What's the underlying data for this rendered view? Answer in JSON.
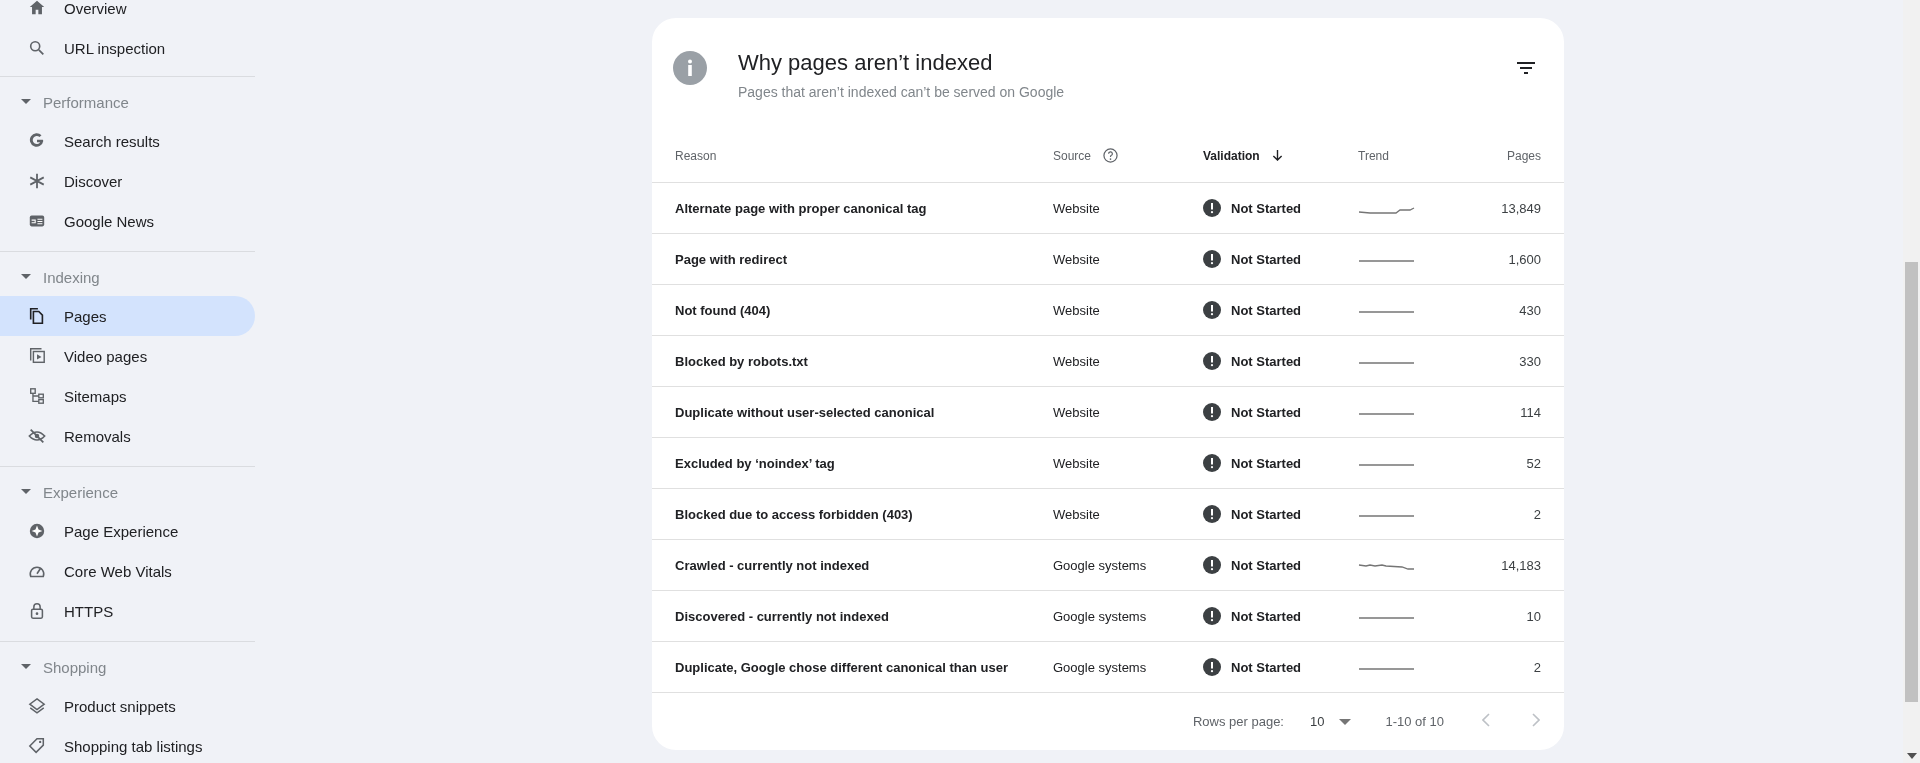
{
  "sidebar": {
    "top_items": [
      {
        "label": "Overview",
        "selected": false
      },
      {
        "label": "URL inspection",
        "selected": false
      }
    ],
    "sections": [
      {
        "title": "Performance",
        "expanded": true,
        "items": [
          {
            "label": "Search results",
            "selected": false
          },
          {
            "label": "Discover",
            "selected": false
          },
          {
            "label": "Google News",
            "selected": false
          }
        ]
      },
      {
        "title": "Indexing",
        "expanded": true,
        "items": [
          {
            "label": "Pages",
            "selected": true
          },
          {
            "label": "Video pages",
            "selected": false
          },
          {
            "label": "Sitemaps",
            "selected": false
          },
          {
            "label": "Removals",
            "selected": false
          }
        ]
      },
      {
        "title": "Experience",
        "expanded": true,
        "items": [
          {
            "label": "Page Experience",
            "selected": false
          },
          {
            "label": "Core Web Vitals",
            "selected": false
          },
          {
            "label": "HTTPS",
            "selected": false
          }
        ]
      },
      {
        "title": "Shopping",
        "expanded": true,
        "items": [
          {
            "label": "Product snippets",
            "selected": false
          },
          {
            "label": "Shopping tab listings",
            "selected": false
          }
        ]
      }
    ]
  },
  "card": {
    "title": "Why pages aren’t indexed",
    "subtitle": "Pages that aren’t indexed can’t be served on Google",
    "columns": [
      {
        "label": "Reason",
        "help": false,
        "sorted": false
      },
      {
        "label": "Source",
        "help": true,
        "sorted": false
      },
      {
        "label": "Validation",
        "help": false,
        "sorted": true
      },
      {
        "label": "Trend",
        "help": false,
        "sorted": false
      },
      {
        "label": "Pages",
        "help": false,
        "sorted": false
      }
    ],
    "rows": [
      {
        "reason": "Alternate page with proper canonical tag",
        "source": "Website",
        "validation": "Not Started",
        "pages": "13,849"
      },
      {
        "reason": "Page with redirect",
        "source": "Website",
        "validation": "Not Started",
        "pages": "1,600"
      },
      {
        "reason": "Not found (404)",
        "source": "Website",
        "validation": "Not Started",
        "pages": "430"
      },
      {
        "reason": "Blocked by robots.txt",
        "source": "Website",
        "validation": "Not Started",
        "pages": "330"
      },
      {
        "reason": "Duplicate without user-selected canonical",
        "source": "Website",
        "validation": "Not Started",
        "pages": "114"
      },
      {
        "reason": "Excluded by ‘noindex’ tag",
        "source": "Website",
        "validation": "Not Started",
        "pages": "52"
      },
      {
        "reason": "Blocked due to access forbidden (403)",
        "source": "Website",
        "validation": "Not Started",
        "pages": "2"
      },
      {
        "reason": "Crawled - currently not indexed",
        "source": "Google systems",
        "validation": "Not Started",
        "pages": "14,183"
      },
      {
        "reason": "Discovered - currently not indexed",
        "source": "Google systems",
        "validation": "Not Started",
        "pages": "10"
      },
      {
        "reason": "Duplicate, Google chose different canonical than user",
        "source": "Google systems",
        "validation": "Not Started",
        "pages": "2"
      }
    ],
    "pagination": {
      "rows_label": "Rows per page:",
      "rows_value": "10",
      "range": "1-10 of 10"
    }
  }
}
